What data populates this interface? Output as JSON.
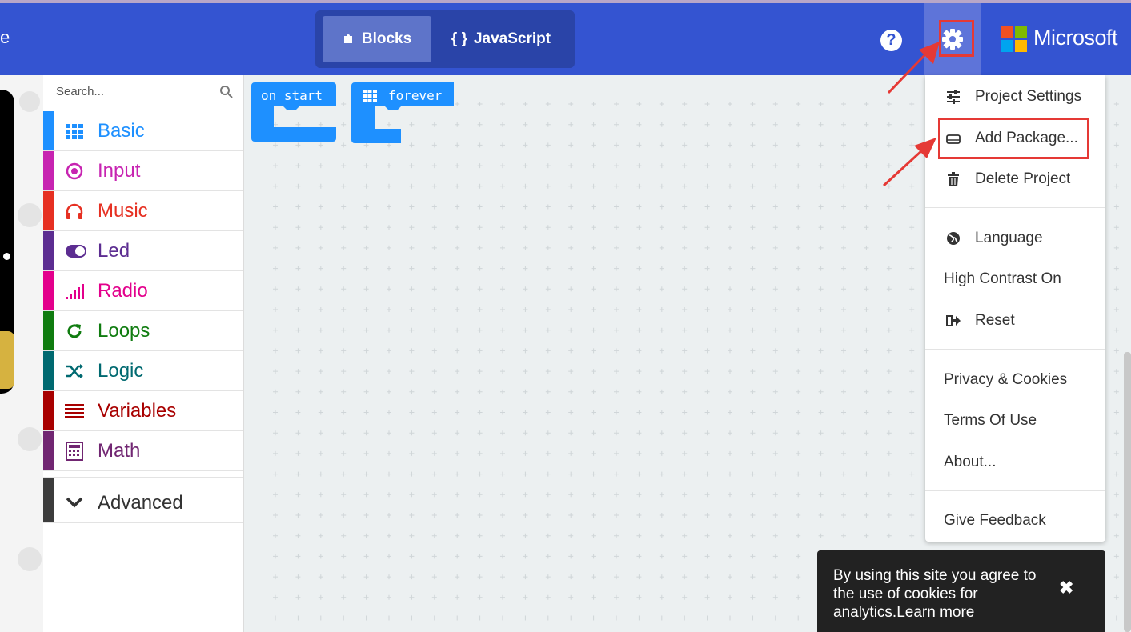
{
  "header": {
    "brand_fragment": "e",
    "editor_toggle": {
      "blocks_label": "Blocks",
      "javascript_label": "JavaScript",
      "javascript_icon": "{ }"
    },
    "help_icon": "?",
    "settings_icon": "gear-icon",
    "microsoft_label": "Microsoft"
  },
  "toolbox": {
    "search_placeholder": "Search...",
    "categories": [
      {
        "label": "Basic",
        "color": "#1e90ff",
        "icon": "grid-icon"
      },
      {
        "label": "Input",
        "color": "#c724b1",
        "icon": "target-icon"
      },
      {
        "label": "Music",
        "color": "#e63022",
        "icon": "headphones-icon"
      },
      {
        "label": "Led",
        "color": "#5c2d91",
        "icon": "toggle-icon"
      },
      {
        "label": "Radio",
        "color": "#e3008c",
        "icon": "signal-icon"
      },
      {
        "label": "Loops",
        "color": "#107c10",
        "icon": "refresh-icon"
      },
      {
        "label": "Logic",
        "color": "#006970",
        "icon": "shuffle-icon"
      },
      {
        "label": "Variables",
        "color": "#a80000",
        "icon": "lines-icon"
      },
      {
        "label": "Math",
        "color": "#712672",
        "icon": "calculator-icon"
      }
    ],
    "advanced_label": "Advanced"
  },
  "workspace": {
    "on_start_label": "on start",
    "forever_label": "forever"
  },
  "settings_menu": {
    "items": [
      {
        "label": "Project Settings",
        "icon": "sliders-icon"
      },
      {
        "label": "Add Package...",
        "icon": "drive-icon"
      },
      {
        "label": "Delete Project",
        "icon": "trash-icon"
      },
      {
        "label": "Language",
        "icon": "globe-icon"
      },
      {
        "label": "High Contrast On",
        "icon": ""
      },
      {
        "label": "Reset",
        "icon": "sign-out-icon"
      },
      {
        "label": "Privacy & Cookies",
        "icon": ""
      },
      {
        "label": "Terms Of Use",
        "icon": ""
      },
      {
        "label": "About...",
        "icon": ""
      },
      {
        "label": "Give Feedback",
        "icon": ""
      }
    ]
  },
  "cookie_banner": {
    "text": "By using this site you agree to the use of cookies for analytics.",
    "link": "Learn more",
    "close": "✖"
  },
  "colors": {
    "header": "#3454d1",
    "highlight": "#e53935"
  }
}
